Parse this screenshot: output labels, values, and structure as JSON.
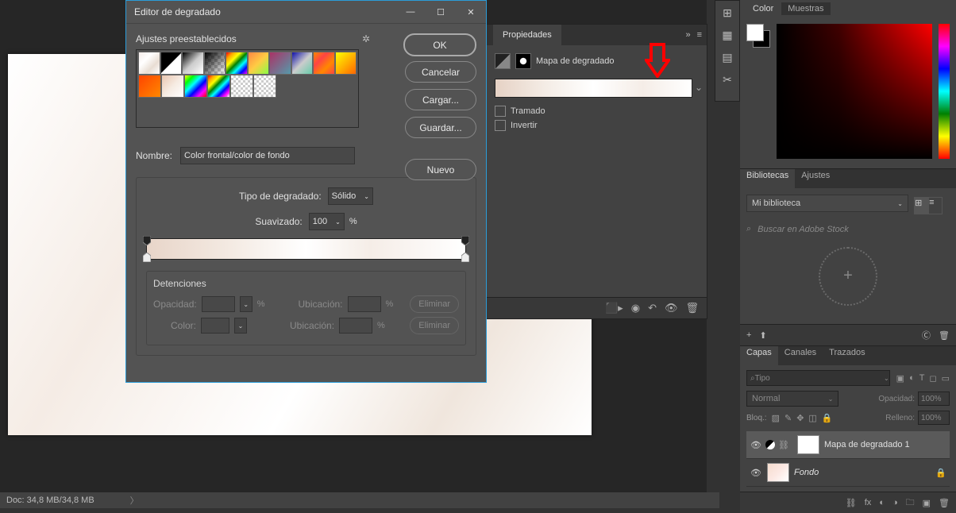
{
  "status_bar": {
    "doc_size": "Doc: 34,8 MB/34,8 MB"
  },
  "dialog": {
    "title": "Editor de degradado",
    "presets_label": "Ajustes preestablecidos",
    "ok": "OK",
    "cancel": "Cancelar",
    "load": "Cargar...",
    "save": "Guardar...",
    "neww": "Nuevo",
    "name_label": "Nombre:",
    "name_value": "Color frontal/color de fondo",
    "type_label": "Tipo de degradado:",
    "type_value": "Sólido",
    "smooth_label": "Suavizado:",
    "smooth_value": "100",
    "stops_title": "Detenciones",
    "opacity_label": "Opacidad:",
    "location_label": "Ubicación:",
    "percent": "%",
    "color_label": "Color:",
    "delete": "Eliminar"
  },
  "properties": {
    "tab": "Propiedades",
    "title": "Mapa de degradado",
    "dither": "Tramado",
    "invert": "Invertir"
  },
  "right": {
    "color_tab": "Color",
    "swatches_tab": "Muestras",
    "libs_tab": "Bibliotecas",
    "adjust_tab": "Ajustes",
    "my_library": "Mi biblioteca",
    "search_placeholder": "Buscar en Adobe Stock",
    "layers_tab": "Capas",
    "channels_tab": "Canales",
    "paths_tab": "Trazados",
    "kind": "Tipo",
    "blend_mode": "Normal",
    "opacity_label": "Opacidad:",
    "opacity_value": "100%",
    "lock_label": "Bloq.:",
    "fill_label": "Relleno:",
    "fill_value": "100%",
    "layer1": "Mapa de degradado 1",
    "layer2": "Fondo"
  }
}
